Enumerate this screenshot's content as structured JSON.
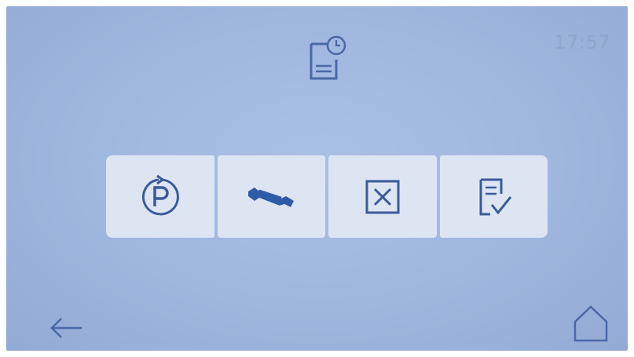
{
  "status": {
    "time": "17:57"
  },
  "header": {
    "icon": "service-log-icon"
  },
  "menu": {
    "items": [
      {
        "name": "parking-program-button",
        "icon": "cycle-p-icon"
      },
      {
        "name": "maintenance-button",
        "icon": "wrench-icon"
      },
      {
        "name": "cancel-button",
        "icon": "close-box-icon"
      },
      {
        "name": "checklist-button",
        "icon": "document-check-icon"
      }
    ]
  },
  "nav": {
    "back_icon": "arrow-left-icon",
    "home_icon": "home-icon"
  },
  "colors": {
    "screen": "#a2b9e2",
    "tile": "#dde5f3",
    "icon": "#3a5a9a"
  }
}
